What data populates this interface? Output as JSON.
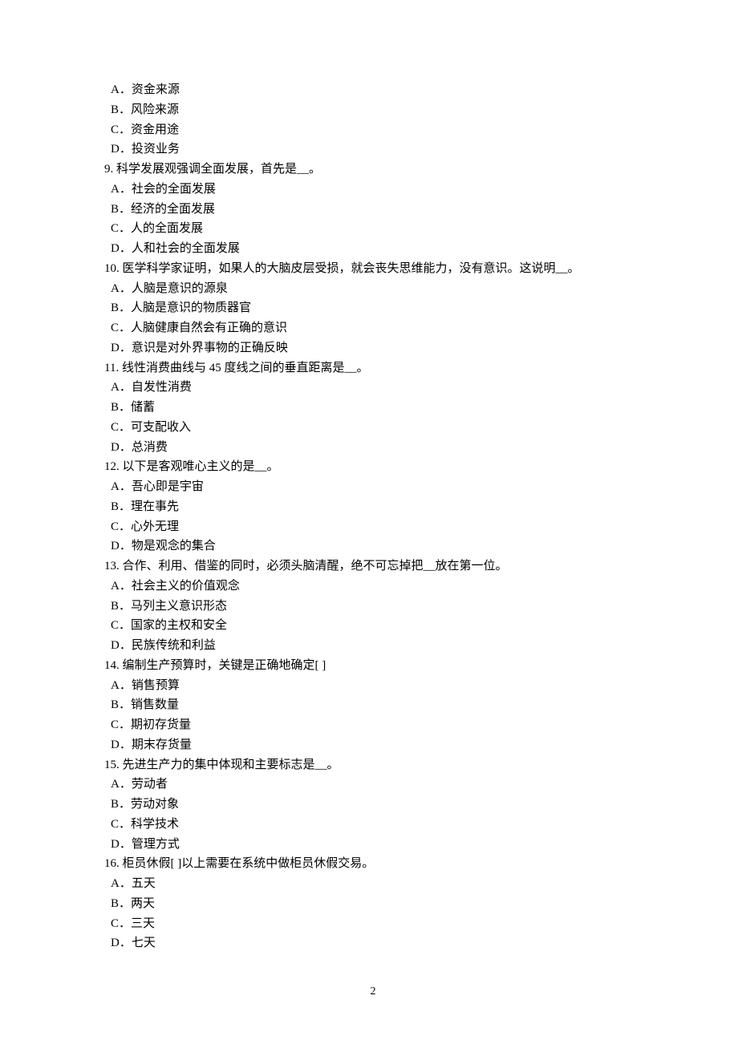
{
  "items": [
    {
      "type": "option",
      "text": "A．资金来源"
    },
    {
      "type": "option",
      "text": "B．风险来源"
    },
    {
      "type": "option",
      "text": "C．资金用途"
    },
    {
      "type": "option",
      "text": "D．投资业务"
    },
    {
      "type": "question",
      "text": "9. 科学发展观强调全面发展，首先是__。"
    },
    {
      "type": "option",
      "text": "A．社会的全面发展"
    },
    {
      "type": "option",
      "text": "B．经济的全面发展"
    },
    {
      "type": "option",
      "text": "C．人的全面发展"
    },
    {
      "type": "option",
      "text": "D．人和社会的全面发展"
    },
    {
      "type": "question",
      "text": "10. 医学科学家证明，如果人的大脑皮层受损，就会丧失思维能力，没有意识。这说明__。"
    },
    {
      "type": "option",
      "text": "A．人脑是意识的源泉"
    },
    {
      "type": "option",
      "text": "B．人脑是意识的物质器官"
    },
    {
      "type": "option",
      "text": "C．人脑健康自然会有正确的意识"
    },
    {
      "type": "option",
      "text": "D．意识是对外界事物的正确反映"
    },
    {
      "type": "question",
      "text": "11. 线性消费曲线与 45 度线之间的垂直距离是__。"
    },
    {
      "type": "option",
      "text": "A．自发性消费"
    },
    {
      "type": "option",
      "text": "B．储蓄"
    },
    {
      "type": "option",
      "text": "C．可支配收入"
    },
    {
      "type": "option",
      "text": "D．总消费"
    },
    {
      "type": "question",
      "text": "12. 以下是客观唯心主义的是__。"
    },
    {
      "type": "option",
      "text": "A．吾心即是宇宙"
    },
    {
      "type": "option",
      "text": "B．理在事先"
    },
    {
      "type": "option",
      "text": "C．心外无理"
    },
    {
      "type": "option",
      "text": "D．物是观念的集合"
    },
    {
      "type": "question",
      "text": "13. 合作、利用、借鉴的同时，必须头脑清醒，绝不可忘掉把__放在第一位。"
    },
    {
      "type": "option",
      "text": "A．社会主义的价值观念"
    },
    {
      "type": "option",
      "text": "B．马列主义意识形态"
    },
    {
      "type": "option",
      "text": "C．国家的主权和安全"
    },
    {
      "type": "option",
      "text": "D．民族传统和利益"
    },
    {
      "type": "question",
      "text": "14. 编制生产预算时，关键是正确地确定[ ]"
    },
    {
      "type": "option",
      "text": "A．销售预算"
    },
    {
      "type": "option",
      "text": "B．销售数量"
    },
    {
      "type": "option",
      "text": "C．期初存货量"
    },
    {
      "type": "option",
      "text": "D．期末存货量"
    },
    {
      "type": "question",
      "text": "15. 先进生产力的集中体现和主要标志是__。"
    },
    {
      "type": "option",
      "text": "A．劳动者"
    },
    {
      "type": "option",
      "text": "B．劳动对象"
    },
    {
      "type": "option",
      "text": "C．科学技术"
    },
    {
      "type": "option",
      "text": "D．管理方式"
    },
    {
      "type": "question",
      "text": "16. 柜员休假[ ]以上需要在系统中做柜员休假交易。"
    },
    {
      "type": "option",
      "text": "A．五天"
    },
    {
      "type": "option",
      "text": "B．两天"
    },
    {
      "type": "option",
      "text": "C．三天"
    },
    {
      "type": "option",
      "text": "D．七天"
    }
  ],
  "page_number": "2"
}
